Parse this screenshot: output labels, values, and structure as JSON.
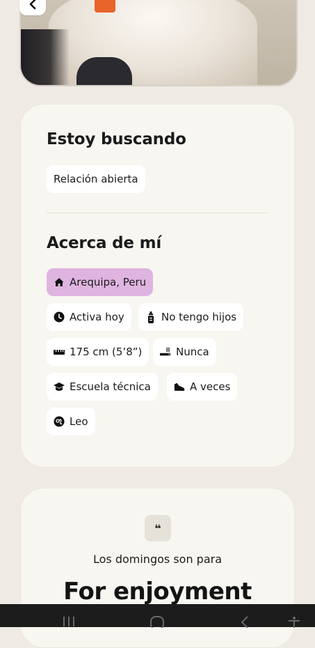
{
  "looking_for": {
    "title": "Estoy buscando",
    "chips": [
      "Relación abierta"
    ]
  },
  "about": {
    "title": "Acerca de mí",
    "chips": [
      {
        "label": "Arequipa, Peru",
        "icon": "home-icon",
        "highlight": true
      },
      {
        "label": "Activa hoy",
        "icon": "clock-icon"
      },
      {
        "label": "No tengo hijos",
        "icon": "baby-bottle-icon"
      },
      {
        "label": "175 cm (5’8”)",
        "icon": "ruler-icon"
      },
      {
        "label": "Nunca",
        "icon": "smoking-icon"
      },
      {
        "label": "Escuela técnica",
        "icon": "graduation-cap-icon"
      },
      {
        "label": "A veces",
        "icon": "sneaker-icon"
      },
      {
        "label": "Leo",
        "icon": "zodiac-icon"
      }
    ]
  },
  "prompt": {
    "quote_mark": "❝",
    "question": "Los domingos son para",
    "answer": "For enjoyment"
  },
  "colors": {
    "background": "#efebe4",
    "card": "#f8f6f0",
    "highlight_chip": "#dfb4e0",
    "navbar": "#1c1c1c"
  }
}
